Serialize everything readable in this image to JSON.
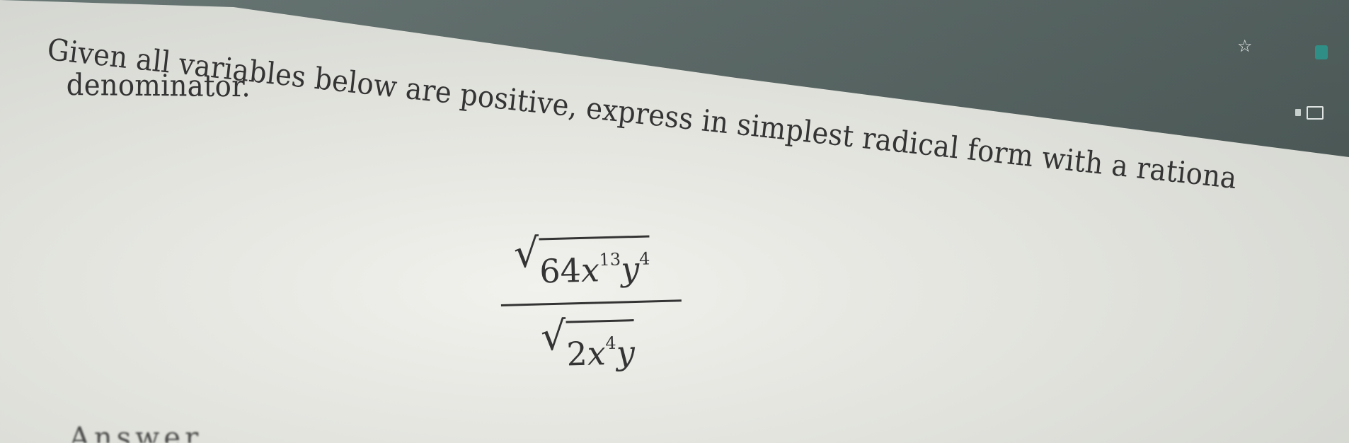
{
  "toolbar": {
    "icons": [
      "star-icon",
      "extension-icon",
      "folder-icon"
    ]
  },
  "question": {
    "line1": "Given all variables below are positive, express in simplest radical form with a rationa",
    "line2": "denominator."
  },
  "expression": {
    "numerator": {
      "coefficient": "64",
      "var1": "x",
      "exp1": "13",
      "var2": "y",
      "exp2": "4"
    },
    "denominator": {
      "coefficient": "2",
      "var1": "x",
      "exp1": "4",
      "var2": "y"
    }
  },
  "answer": {
    "label_partial": "Answer"
  },
  "colors": {
    "text": "#333433",
    "page_background": "#e4e5e0",
    "chrome": "#4f5e5c"
  }
}
